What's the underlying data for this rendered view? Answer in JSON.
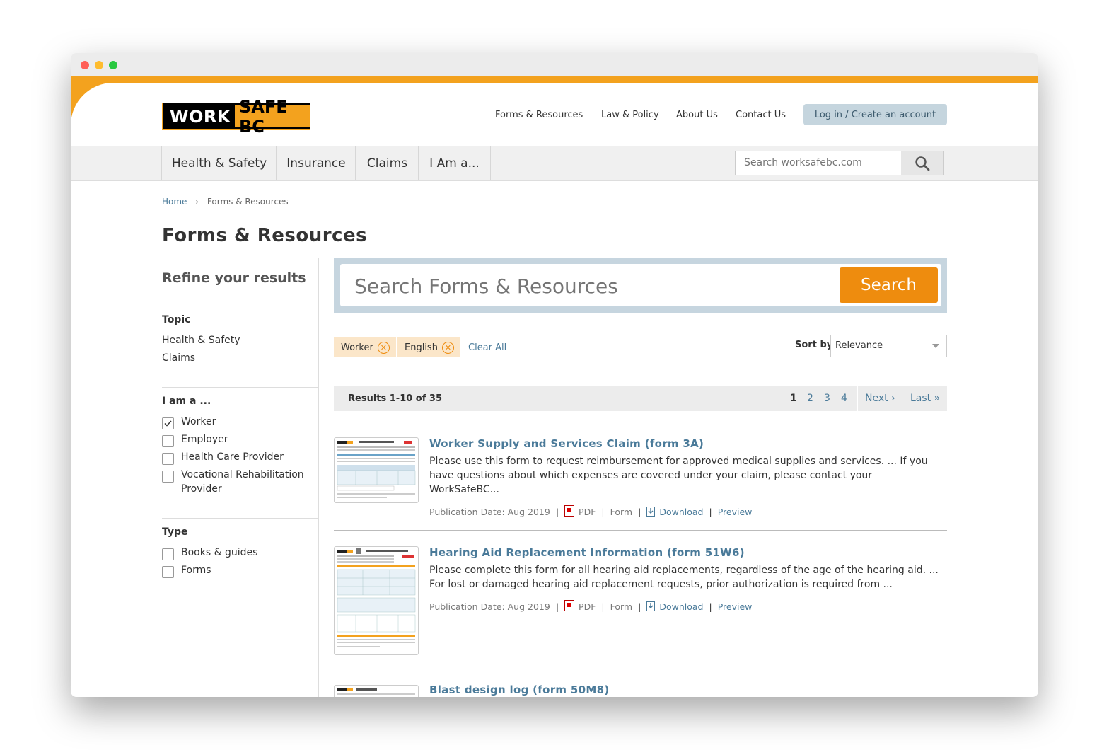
{
  "header": {
    "logo_work": "WORK",
    "logo_safebc": "SAFE BC",
    "links": [
      "Forms & Resources",
      "Law & Policy",
      "About Us",
      "Contact Us"
    ],
    "login_label": "Log in / Create an account"
  },
  "nav": {
    "items": [
      "Health & Safety",
      "Insurance",
      "Claims",
      "I Am a..."
    ],
    "search_placeholder": "Search worksafebc.com"
  },
  "breadcrumb": {
    "home": "Home",
    "separator": "›",
    "current": "Forms & Resources"
  },
  "page_title": "Forms & Resources",
  "sidebar": {
    "refine_title": "Refine your results",
    "topic": {
      "heading": "Topic",
      "links": [
        "Health & Safety",
        "Claims"
      ]
    },
    "iam": {
      "heading": "I am a ...",
      "options": [
        {
          "label": "Worker",
          "checked": true
        },
        {
          "label": "Employer",
          "checked": false
        },
        {
          "label": "Health Care Provider",
          "checked": false
        },
        {
          "label": "Vocational Rehabilitation Provider",
          "checked": false
        }
      ]
    },
    "type": {
      "heading": "Type",
      "options": [
        {
          "label": "Books & guides",
          "checked": false
        },
        {
          "label": "Forms",
          "checked": false
        }
      ]
    }
  },
  "search": {
    "placeholder": "Search Forms & Resources",
    "button": "Search"
  },
  "filters": {
    "chips": [
      "Worker",
      "English"
    ],
    "clear_all": "Clear All",
    "sort_label": "Sort by",
    "sort_value": "Relevance"
  },
  "results_bar": {
    "count_text": "Results 1-10 of 35",
    "pages": [
      "1",
      "2",
      "3",
      "4"
    ],
    "current_page": "1",
    "next": "Next ›",
    "last": "Last »"
  },
  "results": [
    {
      "title": "Worker Supply and Services Claim (form 3A)",
      "description": "Please use this form to request reimbursement for approved medical supplies and services. ... If you have questions about which expenses are covered under your claim, please contact your WorkSafeBC...",
      "publication": "Publication Date: Aug 2019",
      "format": "PDF",
      "kind": "Form",
      "download": "Download",
      "preview": "Preview"
    },
    {
      "title": "Hearing Aid Replacement Information (form 51W6)",
      "description": "Please complete this form for all hearing aid replacements, regardless of the age of the hearing aid. ... For lost or damaged hearing aid replacement requests, prior authorization is required from ...",
      "publication": "Publication Date: Aug 2019",
      "format": "PDF",
      "kind": "Form",
      "download": "Download",
      "preview": "Preview"
    },
    {
      "title": "Blast design log (form 50M8)"
    }
  ],
  "colors": {
    "brand_orange": "#f3a21e",
    "search_orange": "#ee8c0e",
    "link_blue": "#4a7a99",
    "panel_blue": "#c6d5df"
  }
}
